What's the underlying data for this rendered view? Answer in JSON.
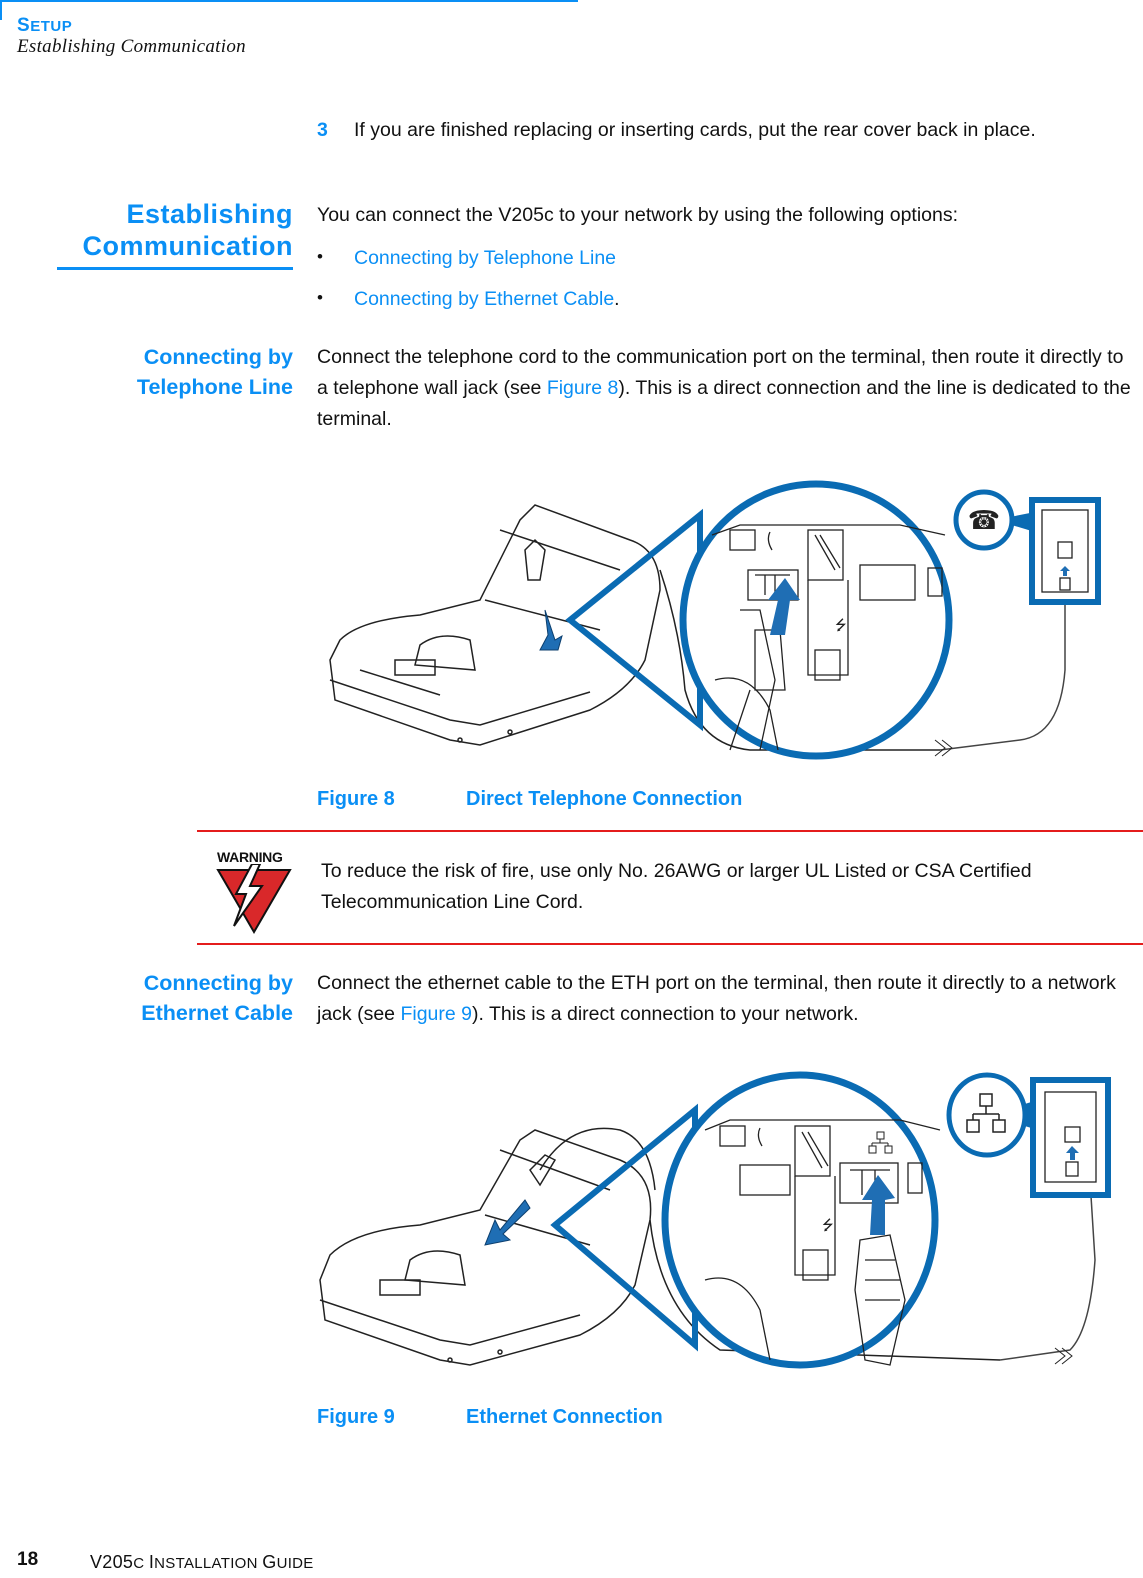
{
  "header": {
    "section_first": "S",
    "section_rest": "ETUP",
    "subtitle": "Establishing Communication"
  },
  "step": {
    "number": "3",
    "text": "If you are finished replacing or inserting cards, put the rear cover back in place."
  },
  "establishing": {
    "heading_line1": "Establishing",
    "heading_line2": "Communication",
    "intro": "You can connect the V205c to your network by using the following options:",
    "options": [
      {
        "label": "Connecting by Telephone Line",
        "suffix": ""
      },
      {
        "label": "Connecting by Ethernet Cable",
        "suffix": "."
      }
    ],
    "bullet_glyph": "•"
  },
  "telephone": {
    "heading_line1": "Connecting by",
    "heading_line2": "Telephone Line",
    "text_before": "Connect the telephone cord to the communication port on the terminal, then route it directly to a telephone wall jack (see ",
    "link": "Figure 8",
    "text_after": "). This is a direct connection and the line is dedicated to the terminal.",
    "figure": {
      "number": "Figure 8",
      "title": "Direct Telephone Connection",
      "accent_color": "#0a6bb3"
    }
  },
  "warning": {
    "label": "WARNING",
    "text": "To reduce the risk of fire, use only No. 26AWG or larger UL Listed or CSA Certified Telecommunication Line Cord.",
    "rule_color": "#e41c1c"
  },
  "ethernet": {
    "heading_line1": "Connecting by",
    "heading_line2": "Ethernet Cable",
    "text_before": "Connect the ethernet cable to the ETH port on the terminal, then route it directly to a network jack (see ",
    "link": "Figure 9",
    "text_after": "). This is a direct connection to your network.",
    "figure": {
      "number": "Figure 9",
      "title": "Ethernet Connection",
      "accent_color": "#0a6bb3"
    }
  },
  "footer": {
    "page_number": "18",
    "guide_v": "V205",
    "guide_c": "C",
    "guide_i": "I",
    "guide_nstallation": "NSTALLATION",
    "guide_g": "G",
    "guide_uide": "UIDE"
  },
  "colors": {
    "brand_blue": "#0a8ff5",
    "figure_blue": "#0a6bb3",
    "warning_red": "#e41c1c"
  }
}
